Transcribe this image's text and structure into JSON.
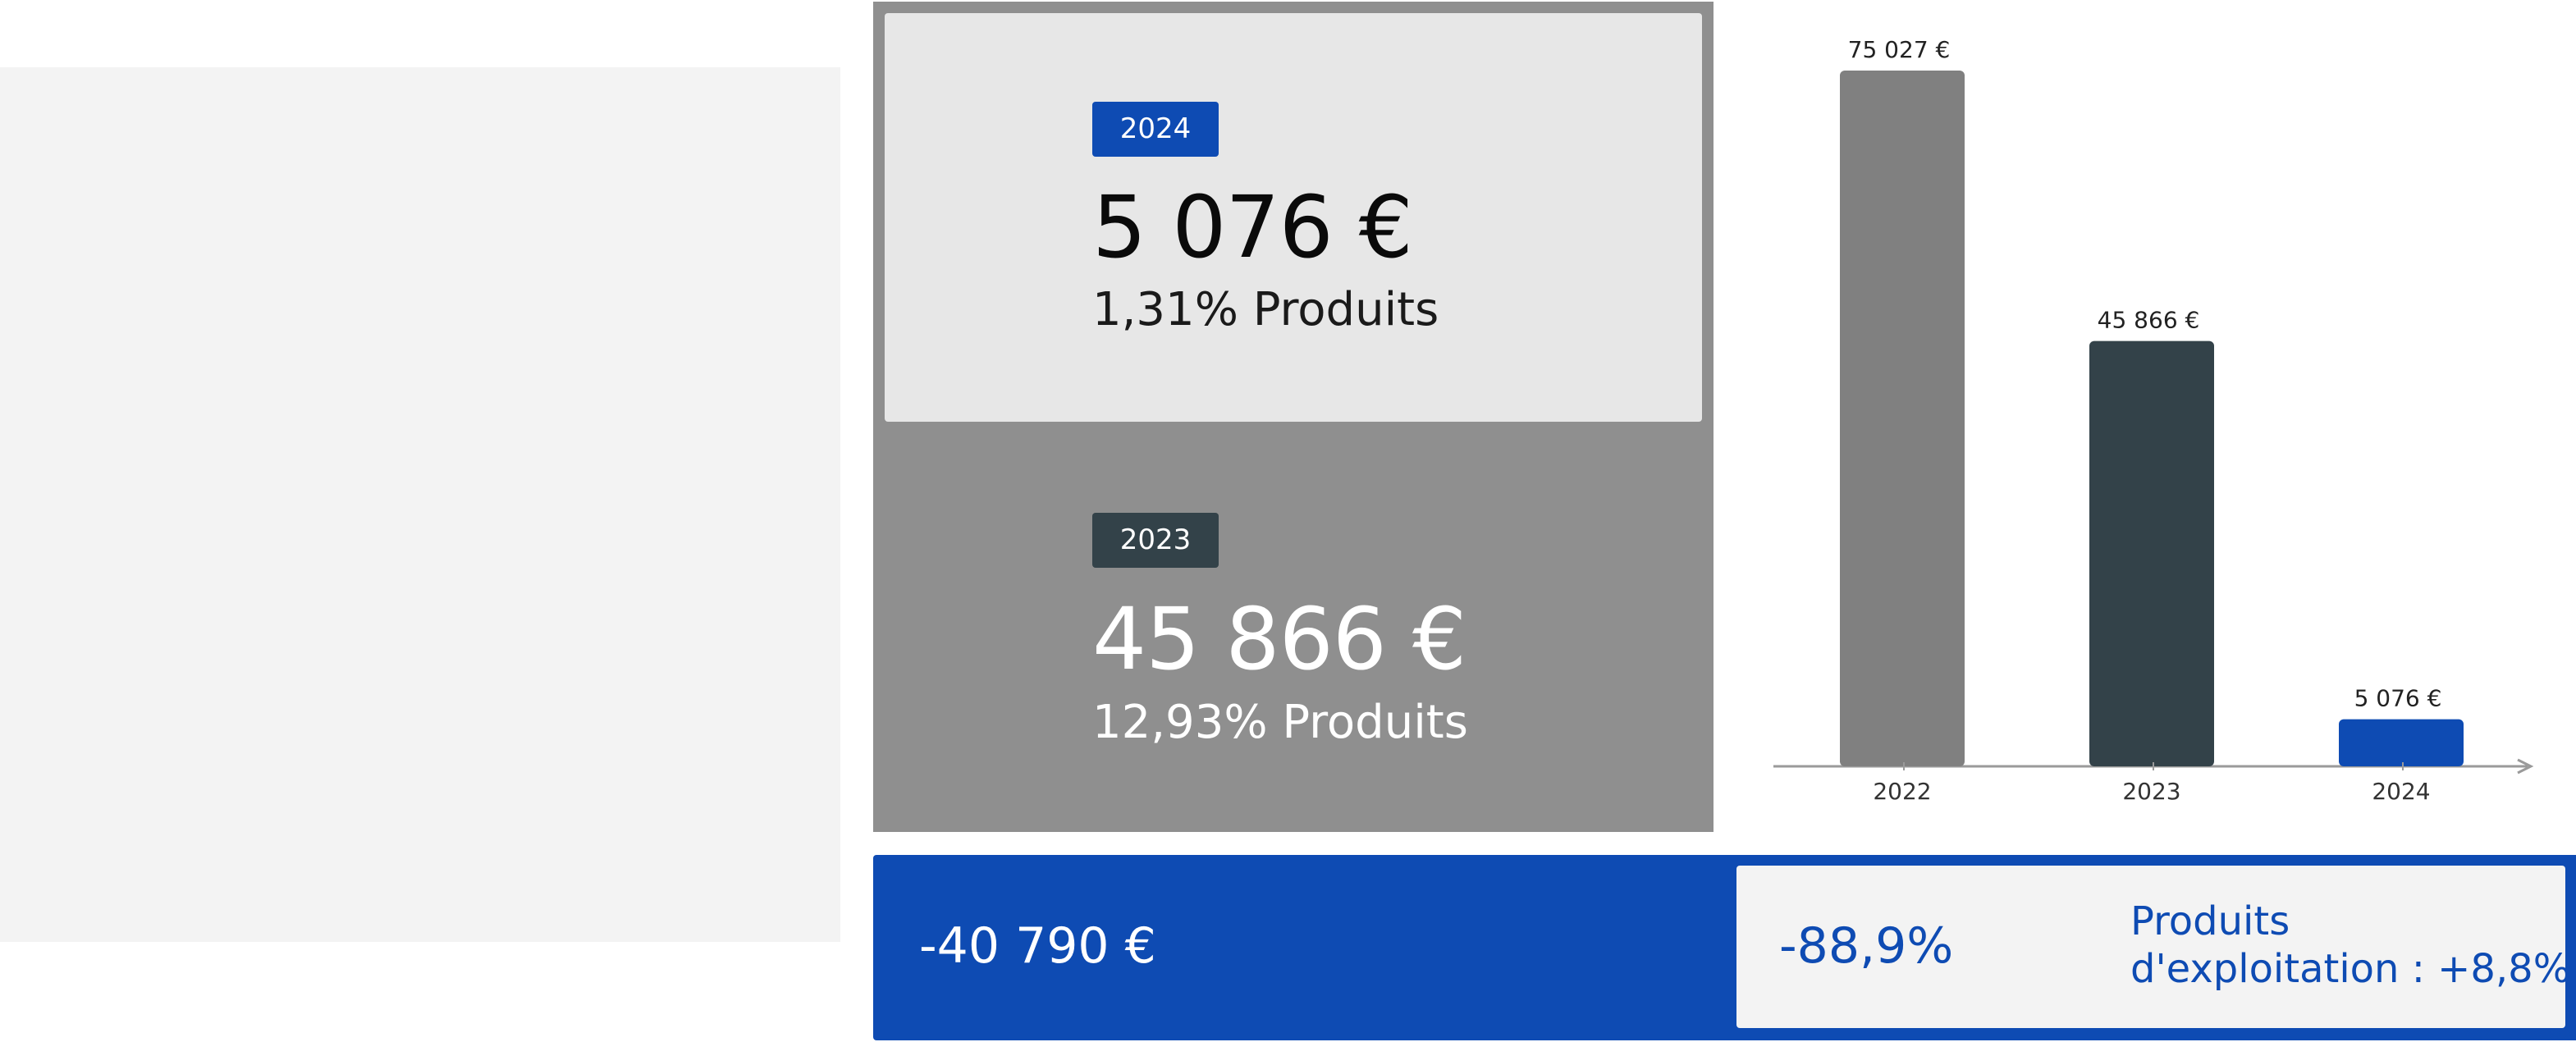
{
  "kpi": {
    "current": {
      "year": "2024",
      "value": "5 076 €",
      "share": "1,31% Produits"
    },
    "previous": {
      "year": "2023",
      "value": "45 866 €",
      "share": "12,93% Produits"
    }
  },
  "footer": {
    "delta_abs": "-40 790 €",
    "delta_pct": "-88,9%",
    "reference_line1": "Produits",
    "reference_line2": "d'exploitation : +8,8%"
  },
  "colors": {
    "accent": "#0e4bb3",
    "dark": "#334249",
    "grey": "#808080",
    "panel_grey": "#8f8f8f",
    "light": "#f3f3f3"
  },
  "chart_data": {
    "type": "bar",
    "categories": [
      "2022",
      "2023",
      "2024"
    ],
    "values": [
      75027,
      45866,
      5076
    ],
    "value_labels": [
      "75 027 €",
      "45 866 €",
      "5 076 €"
    ],
    "bar_colors": [
      "#808080",
      "#334249",
      "#0e4bb3"
    ],
    "title": "",
    "xlabel": "",
    "ylabel": "",
    "ylim": [
      0,
      75027
    ],
    "grid": false,
    "legend": "none"
  }
}
